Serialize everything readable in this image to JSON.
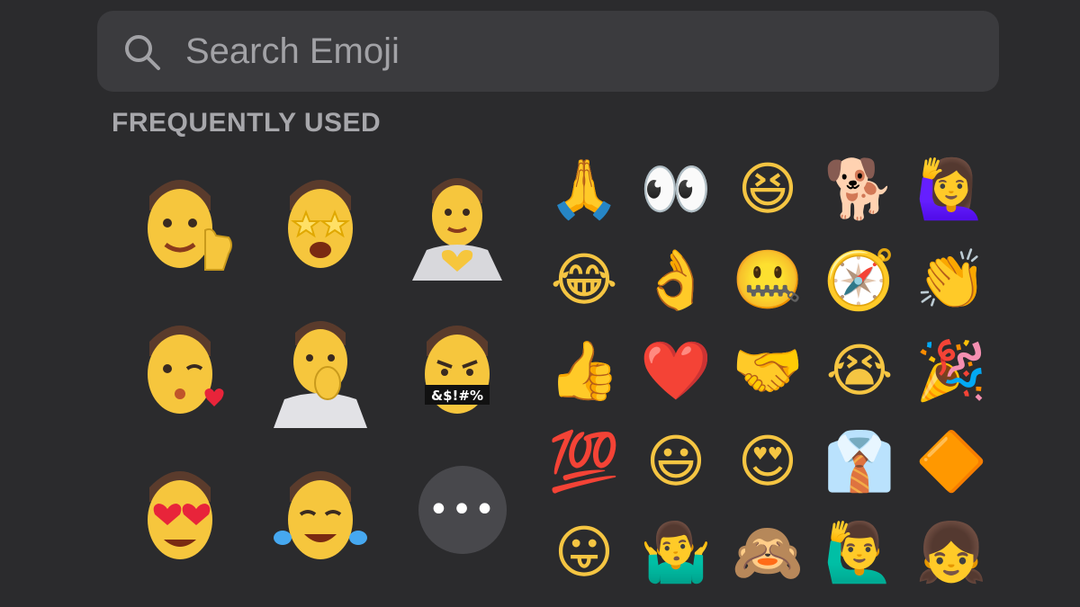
{
  "search": {
    "placeholder": "Search Emoji",
    "icon": "search-icon"
  },
  "section": {
    "title": "FREQUENTLY USED"
  },
  "memoji": [
    {
      "name": "memoji-thumbs-up"
    },
    {
      "name": "memoji-star-struck"
    },
    {
      "name": "memoji-heart-hands"
    },
    {
      "name": "memoji-wink-kiss"
    },
    {
      "name": "memoji-thinking"
    },
    {
      "name": "memoji-cursing"
    },
    {
      "name": "memoji-heart-eyes"
    },
    {
      "name": "memoji-tears-of-joy"
    }
  ],
  "more_button": {
    "label": "•••",
    "icon": "ellipsis-icon"
  },
  "emoji": [
    "🙏",
    "👀",
    "😆",
    "🐕",
    "🙋‍♀️",
    "😂",
    "👌",
    "🤐",
    "🧭",
    "👏",
    "👍",
    "❤️",
    "🤝",
    "😭",
    "🎉",
    "💯",
    "😃",
    "😍",
    "👔",
    "🔶",
    "😛",
    "🤷‍♂️",
    "🙈",
    "🙋‍♂️",
    "👧"
  ],
  "colors": {
    "background": "#2b2b2d",
    "search_field": "#3b3b3e",
    "muted_text": "#a7a7ab",
    "memoji_skin": "#f6c63d",
    "memoji_hair": "#5a3b2c"
  }
}
